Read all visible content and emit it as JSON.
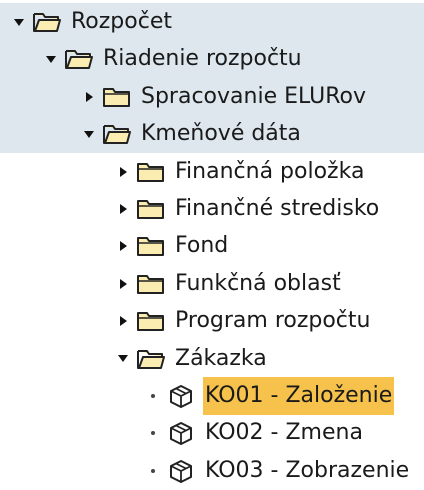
{
  "colors": {
    "band_tint": "#dde7ed",
    "selection": "#f6c24b",
    "folder_fill": "#fbedb1",
    "folder_stroke": "#222222"
  },
  "tree": [
    {
      "label": "Rozpočet",
      "level": 0,
      "toggle": "expanded",
      "icon": "folder-open-icon",
      "band": true
    },
    {
      "label": "Riadenie rozpočtu",
      "level": 1,
      "toggle": "expanded",
      "icon": "folder-open-icon",
      "band": true
    },
    {
      "label": "Spracovanie ELURov",
      "level": 2,
      "toggle": "collapsed",
      "icon": "folder-icon",
      "band": true
    },
    {
      "label": "Kmeňové dáta",
      "level": 2,
      "toggle": "expanded",
      "icon": "folder-open-icon",
      "band": true
    },
    {
      "label": "Finančná položka",
      "level": 3,
      "toggle": "collapsed",
      "icon": "folder-icon",
      "band": false
    },
    {
      "label": "Finančné stredisko",
      "level": 3,
      "toggle": "collapsed",
      "icon": "folder-icon",
      "band": false
    },
    {
      "label": "Fond",
      "level": 3,
      "toggle": "collapsed",
      "icon": "folder-icon",
      "band": false
    },
    {
      "label": "Funkčná oblasť",
      "level": 3,
      "toggle": "collapsed",
      "icon": "folder-icon",
      "band": false
    },
    {
      "label": "Program rozpočtu",
      "level": 3,
      "toggle": "collapsed",
      "icon": "folder-icon",
      "band": false
    },
    {
      "label": "Zákazka",
      "level": 3,
      "toggle": "expanded",
      "icon": "folder-open-icon",
      "band": false
    },
    {
      "label": "KO01 - Založenie",
      "level": 4,
      "toggle": "leaf",
      "icon": "transaction-cube-icon",
      "band": false,
      "selected": true
    },
    {
      "label": "KO02 - Zmena",
      "level": 4,
      "toggle": "leaf",
      "icon": "transaction-cube-icon",
      "band": false
    },
    {
      "label": "KO03 - Zobrazenie",
      "level": 4,
      "toggle": "leaf",
      "icon": "transaction-cube-icon",
      "band": false
    }
  ]
}
